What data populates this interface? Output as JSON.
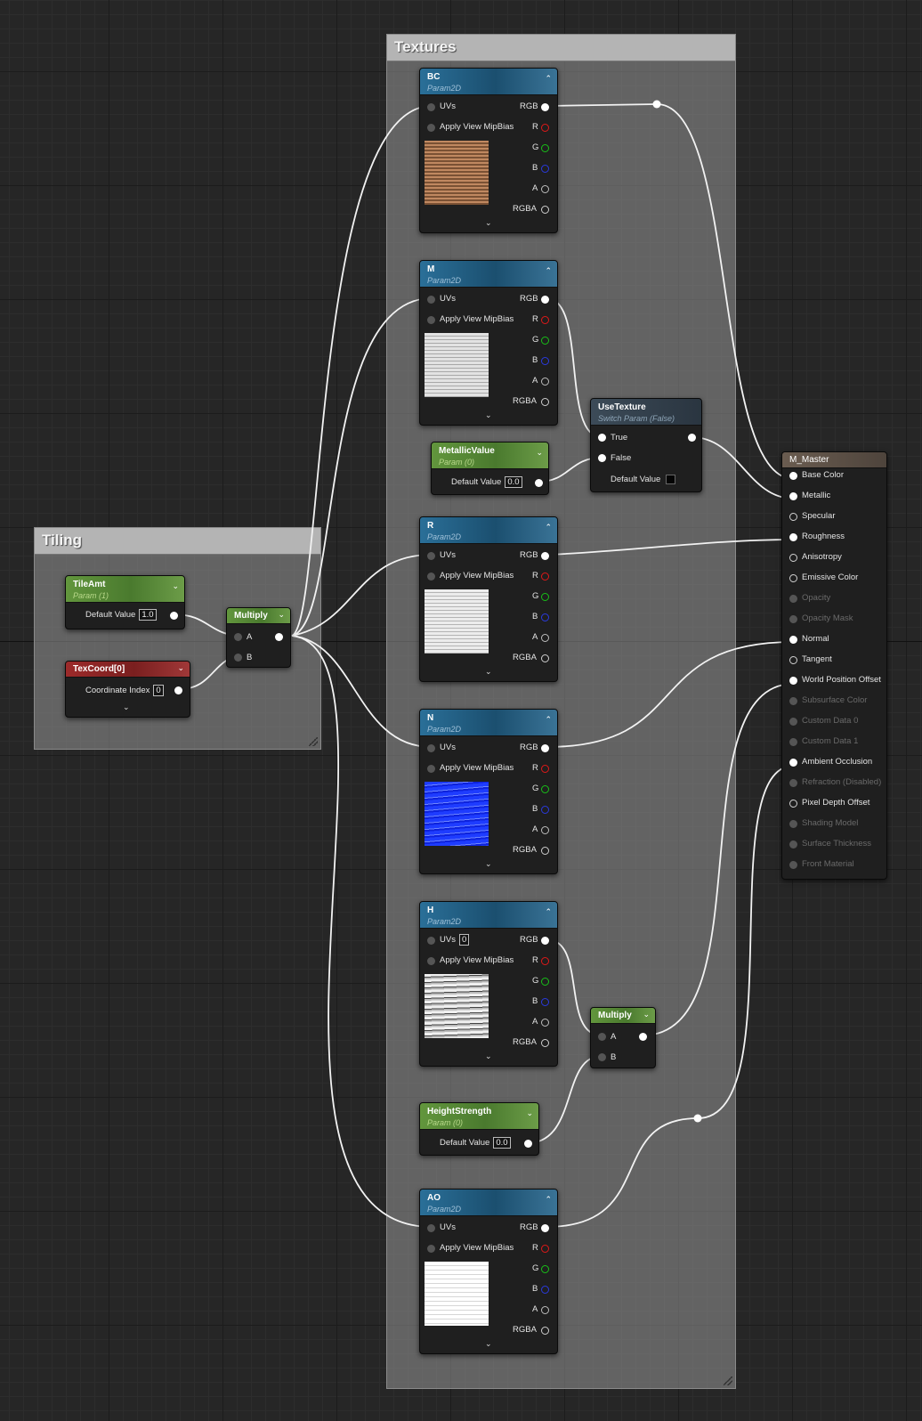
{
  "comments": {
    "textures": "Textures",
    "tiling": "Tiling"
  },
  "nodes": {
    "bc": {
      "title": "BC",
      "sub": "Param2D"
    },
    "m": {
      "title": "M",
      "sub": "Param2D"
    },
    "r": {
      "title": "R",
      "sub": "Param2D"
    },
    "n": {
      "title": "N",
      "sub": "Param2D"
    },
    "h": {
      "title": "H",
      "sub": "Param2D",
      "uv_value": "0"
    },
    "ao": {
      "title": "AO",
      "sub": "Param2D"
    },
    "metallic": {
      "title": "MetallicValue",
      "sub": "Param (0)",
      "label": "Default Value",
      "value": "0.0"
    },
    "height": {
      "title": "HeightStrength",
      "sub": "Param (0)",
      "label": "Default Value",
      "value": "0.0"
    },
    "tile": {
      "title": "TileAmt",
      "sub": "Param (1)",
      "label": "Default Value",
      "value": "1.0"
    },
    "texcoord": {
      "title": "TexCoord[0]",
      "label": "Coordinate Index",
      "value": "0"
    },
    "multiply1": {
      "title": "Multiply",
      "a": "A",
      "b": "B"
    },
    "multiply2": {
      "title": "Multiply",
      "a": "A",
      "b": "B"
    },
    "switch": {
      "title": "UseTexture",
      "sub": "Switch Param (False)",
      "true_label": "True",
      "false_label": "False",
      "default_label": "Default Value"
    }
  },
  "texpins": {
    "uvs": "UVs",
    "mip": "Apply View MipBias",
    "rgb": "RGB",
    "r": "R",
    "g": "G",
    "b": "B",
    "a": "A",
    "rgba": "RGBA"
  },
  "master": {
    "title": "M_Master",
    "pins": [
      {
        "label": "Base Color",
        "state": "on"
      },
      {
        "label": "Metallic",
        "state": "on"
      },
      {
        "label": "Specular",
        "state": "off"
      },
      {
        "label": "Roughness",
        "state": "on"
      },
      {
        "label": "Anisotropy",
        "state": "off"
      },
      {
        "label": "Emissive Color",
        "state": "off"
      },
      {
        "label": "Opacity",
        "state": "dim"
      },
      {
        "label": "Opacity Mask",
        "state": "dim"
      },
      {
        "label": "Normal",
        "state": "on"
      },
      {
        "label": "Tangent",
        "state": "off"
      },
      {
        "label": "World Position Offset",
        "state": "on"
      },
      {
        "label": "Subsurface Color",
        "state": "dim"
      },
      {
        "label": "Custom Data 0",
        "state": "dim"
      },
      {
        "label": "Custom Data 1",
        "state": "dim"
      },
      {
        "label": "Ambient Occlusion",
        "state": "on"
      },
      {
        "label": "Refraction (Disabled)",
        "state": "dim"
      },
      {
        "label": "Pixel Depth Offset",
        "state": "off"
      },
      {
        "label": "Shading Model",
        "state": "dim"
      },
      {
        "label": "Surface Thickness",
        "state": "dim"
      },
      {
        "label": "Front Material",
        "state": "dim"
      }
    ]
  },
  "colors": {
    "wire": "#f2f2f2",
    "texture_header": "#2a6f98",
    "param_header": "#62963d",
    "texcoord_header": "#9c2a2a"
  }
}
